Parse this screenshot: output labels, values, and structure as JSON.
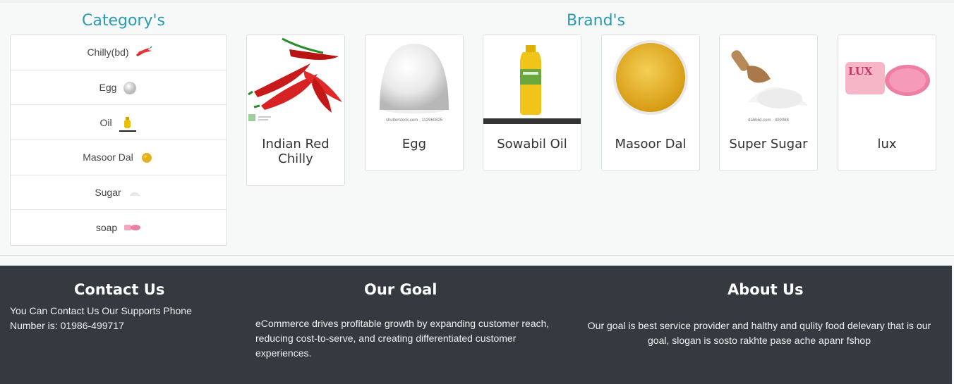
{
  "categories": {
    "title": "Category's",
    "items": [
      {
        "label": "Chilly(bd)",
        "icon": "chilly-icon"
      },
      {
        "label": "Egg",
        "icon": "egg-icon"
      },
      {
        "label": "Oil",
        "icon": "oil-icon"
      },
      {
        "label": "Masoor Dal",
        "icon": "dal-icon"
      },
      {
        "label": "Sugar",
        "icon": "sugar-icon"
      },
      {
        "label": "soap",
        "icon": "soap-icon"
      }
    ]
  },
  "brands": {
    "title": "Brand's",
    "items": [
      {
        "name": "Indian Red Chilly",
        "image": "chilly-image"
      },
      {
        "name": "Egg",
        "image": "egg-image",
        "caption": "shutterstock.com · 112960825"
      },
      {
        "name": "Sowabil Oil",
        "image": "oil-bottle-image"
      },
      {
        "name": "Masoor Dal",
        "image": "dal-bowl-image"
      },
      {
        "name": "Super Sugar",
        "image": "sugar-scoop-image",
        "caption": "dahbild.com · 409088"
      },
      {
        "name": "lux",
        "image": "lux-soap-image",
        "logo_text": "LUX"
      }
    ]
  },
  "footer": {
    "contact": {
      "title": "Contact Us",
      "text": "You Can Contact Us Our Supports Phone Number is: 01986-499717"
    },
    "goal": {
      "title": "Our Goal",
      "text": "eCommerce drives profitable growth by expanding customer reach, reducing cost-to-serve, and creating differentiated customer experiences."
    },
    "about": {
      "title": "About Us",
      "text": "Our goal is best service provider and halthy and qulity food delevary that is our goal, slogan is sosto rakhte pase ache apanr fshop"
    }
  },
  "colors": {
    "accent": "#2a9bb0",
    "footer_bg": "#343a40"
  }
}
